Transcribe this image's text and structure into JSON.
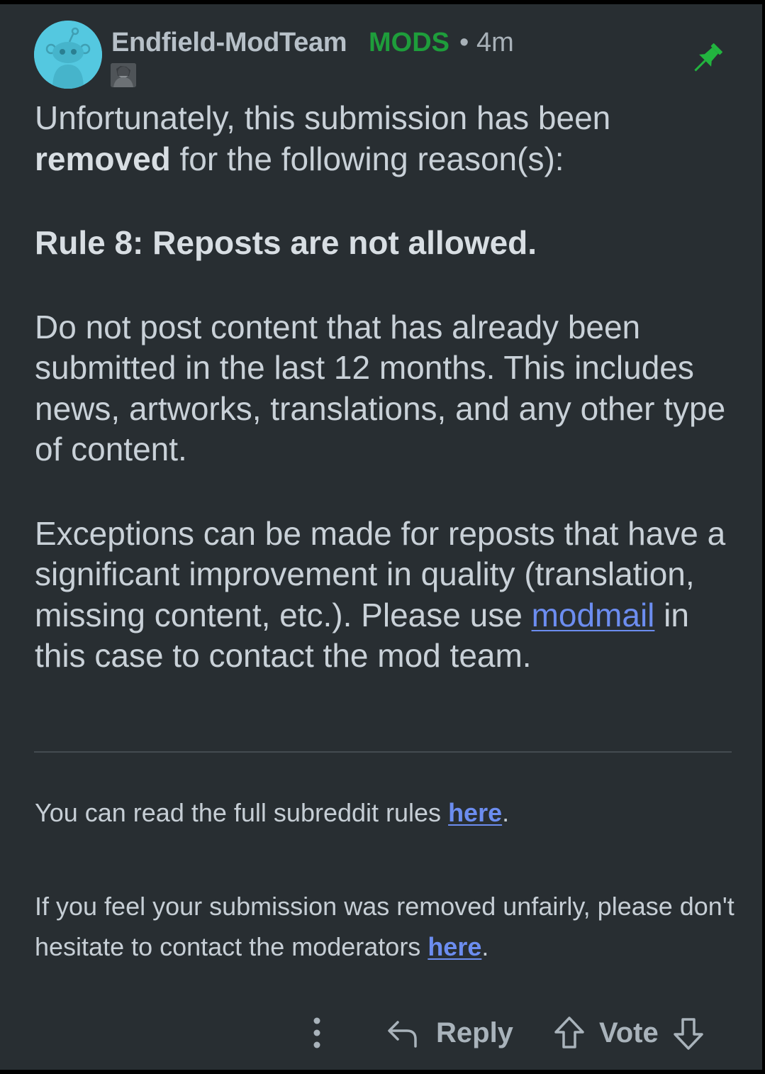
{
  "comment": {
    "author": "Endfield-ModTeam",
    "badge": "MODS",
    "separator": "•",
    "age": "4m",
    "body": {
      "p1_text": "Unfortunately, this submission has been ",
      "p1_bold": "removed",
      "p1_rest": " for the following reason(s):",
      "rule_title": "Rule 8: Reposts are not allowed.",
      "p2": "Do not post content that has already been submitted in the last 12 months. This includes news, artworks, translations, and any other type of content.",
      "p3_before": "Exceptions can be made for reposts that have a significant improvement in quality (translation, missing content, etc.). Please use ",
      "p3_link": "modmail",
      "p3_after": " in this case to contact the mod team."
    },
    "footer": {
      "rules_text": "You can read the full subreddit rules ",
      "rules_link": "here",
      "rules_end": ".",
      "contact_text": "If you feel your submission was removed unfairly, please don't hesitate to contact the moderators ",
      "contact_link": "here",
      "contact_end": "."
    }
  },
  "actions": {
    "more_icon": "more-vertical-icon",
    "reply_icon": "reply-arrow-icon",
    "reply_label": "Reply",
    "upvote_icon": "upvote-arrow-icon",
    "vote_label": "Vote",
    "downvote_icon": "downvote-arrow-icon"
  },
  "colors": {
    "background": "#282e32",
    "mods_badge": "#1e9d3b",
    "pin": "#22b43f",
    "link": "#6c8df0",
    "avatar": "#54c8e0"
  }
}
